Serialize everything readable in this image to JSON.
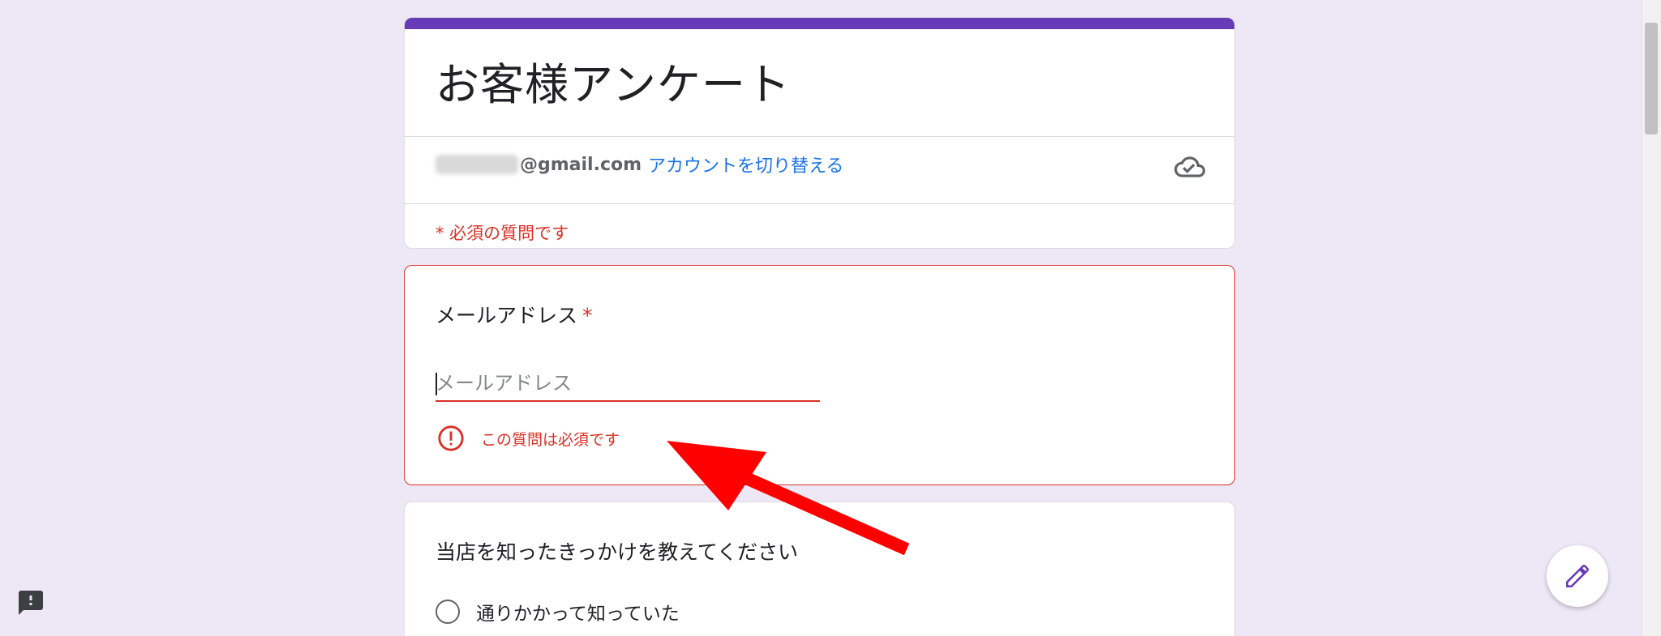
{
  "form": {
    "title": "お客様アンケート",
    "account_email_domain": "@gmail.com",
    "switch_account_label": "アカウントを切り替える",
    "required_note": "* 必須の質問です"
  },
  "question_email": {
    "title": "メールアドレス",
    "asterisk": "*",
    "placeholder": "メールアドレス",
    "value": "",
    "error_text": "この質問は必須です"
  },
  "question_source": {
    "title": "当店を知ったきっかけを教えてください",
    "options": [
      "通りかかって知っていた"
    ]
  },
  "colors": {
    "accent": "#673ab7",
    "background": "#ede7f6",
    "error": "#d93025",
    "link": "#1a73e8",
    "annotation_arrow": "#ff0000"
  },
  "icons": {
    "cloud": "cloud-saved-icon",
    "error": "error-circle-icon",
    "edit": "pencil-icon",
    "feedback": "feedback-icon"
  }
}
